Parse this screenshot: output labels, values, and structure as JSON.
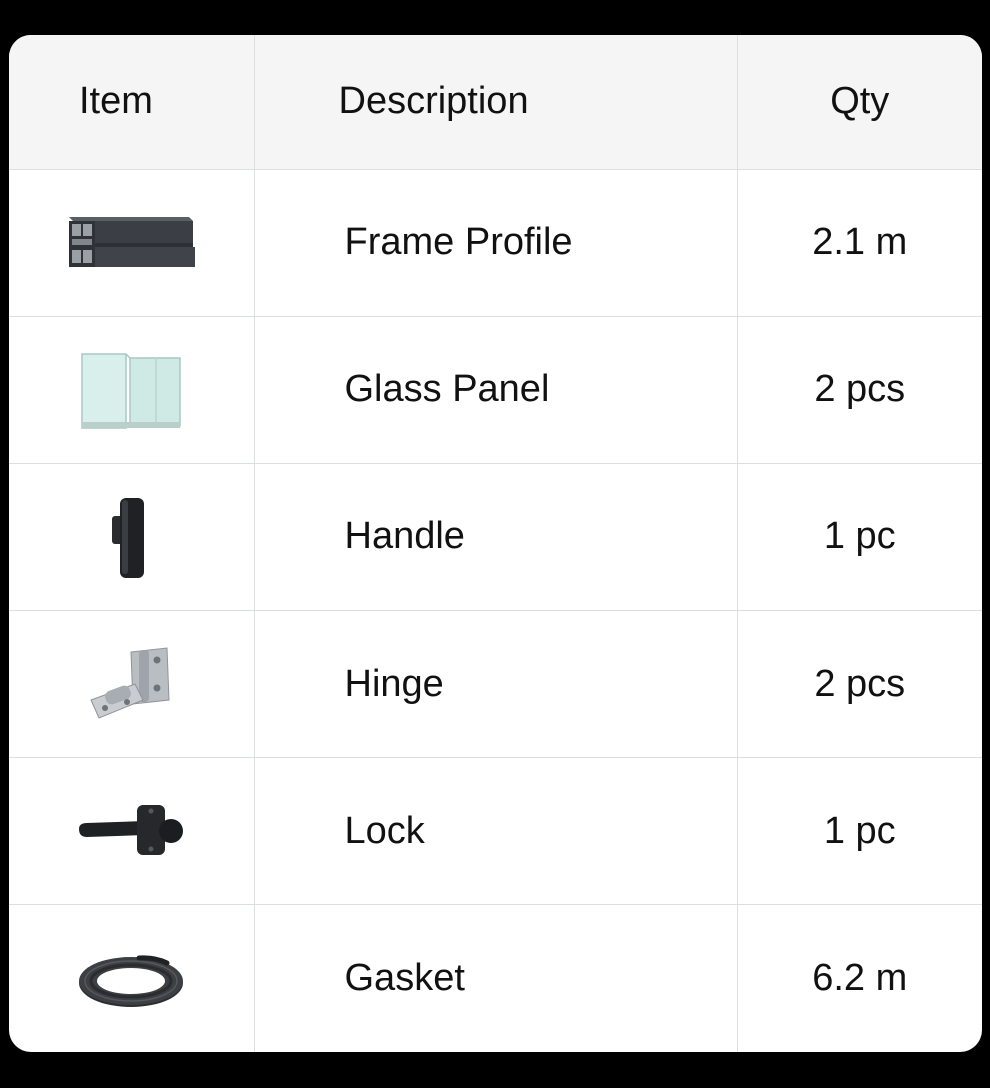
{
  "table": {
    "headers": {
      "item": "Item",
      "description": "Description",
      "qty": "Qty"
    },
    "rows": [
      {
        "icon": "frame-profile-icon",
        "description": "Frame Profile",
        "qty": "2.1 m"
      },
      {
        "icon": "glass-panel-icon",
        "description": "Glass Panel",
        "qty": "2 pcs"
      },
      {
        "icon": "handle-icon",
        "description": "Handle",
        "qty": "1 pc"
      },
      {
        "icon": "hinge-icon",
        "description": "Hinge",
        "qty": "2 pcs"
      },
      {
        "icon": "lock-icon",
        "description": "Lock",
        "qty": "1 pc"
      },
      {
        "icon": "gasket-icon",
        "description": "Gasket",
        "qty": "6.2 m"
      }
    ]
  }
}
